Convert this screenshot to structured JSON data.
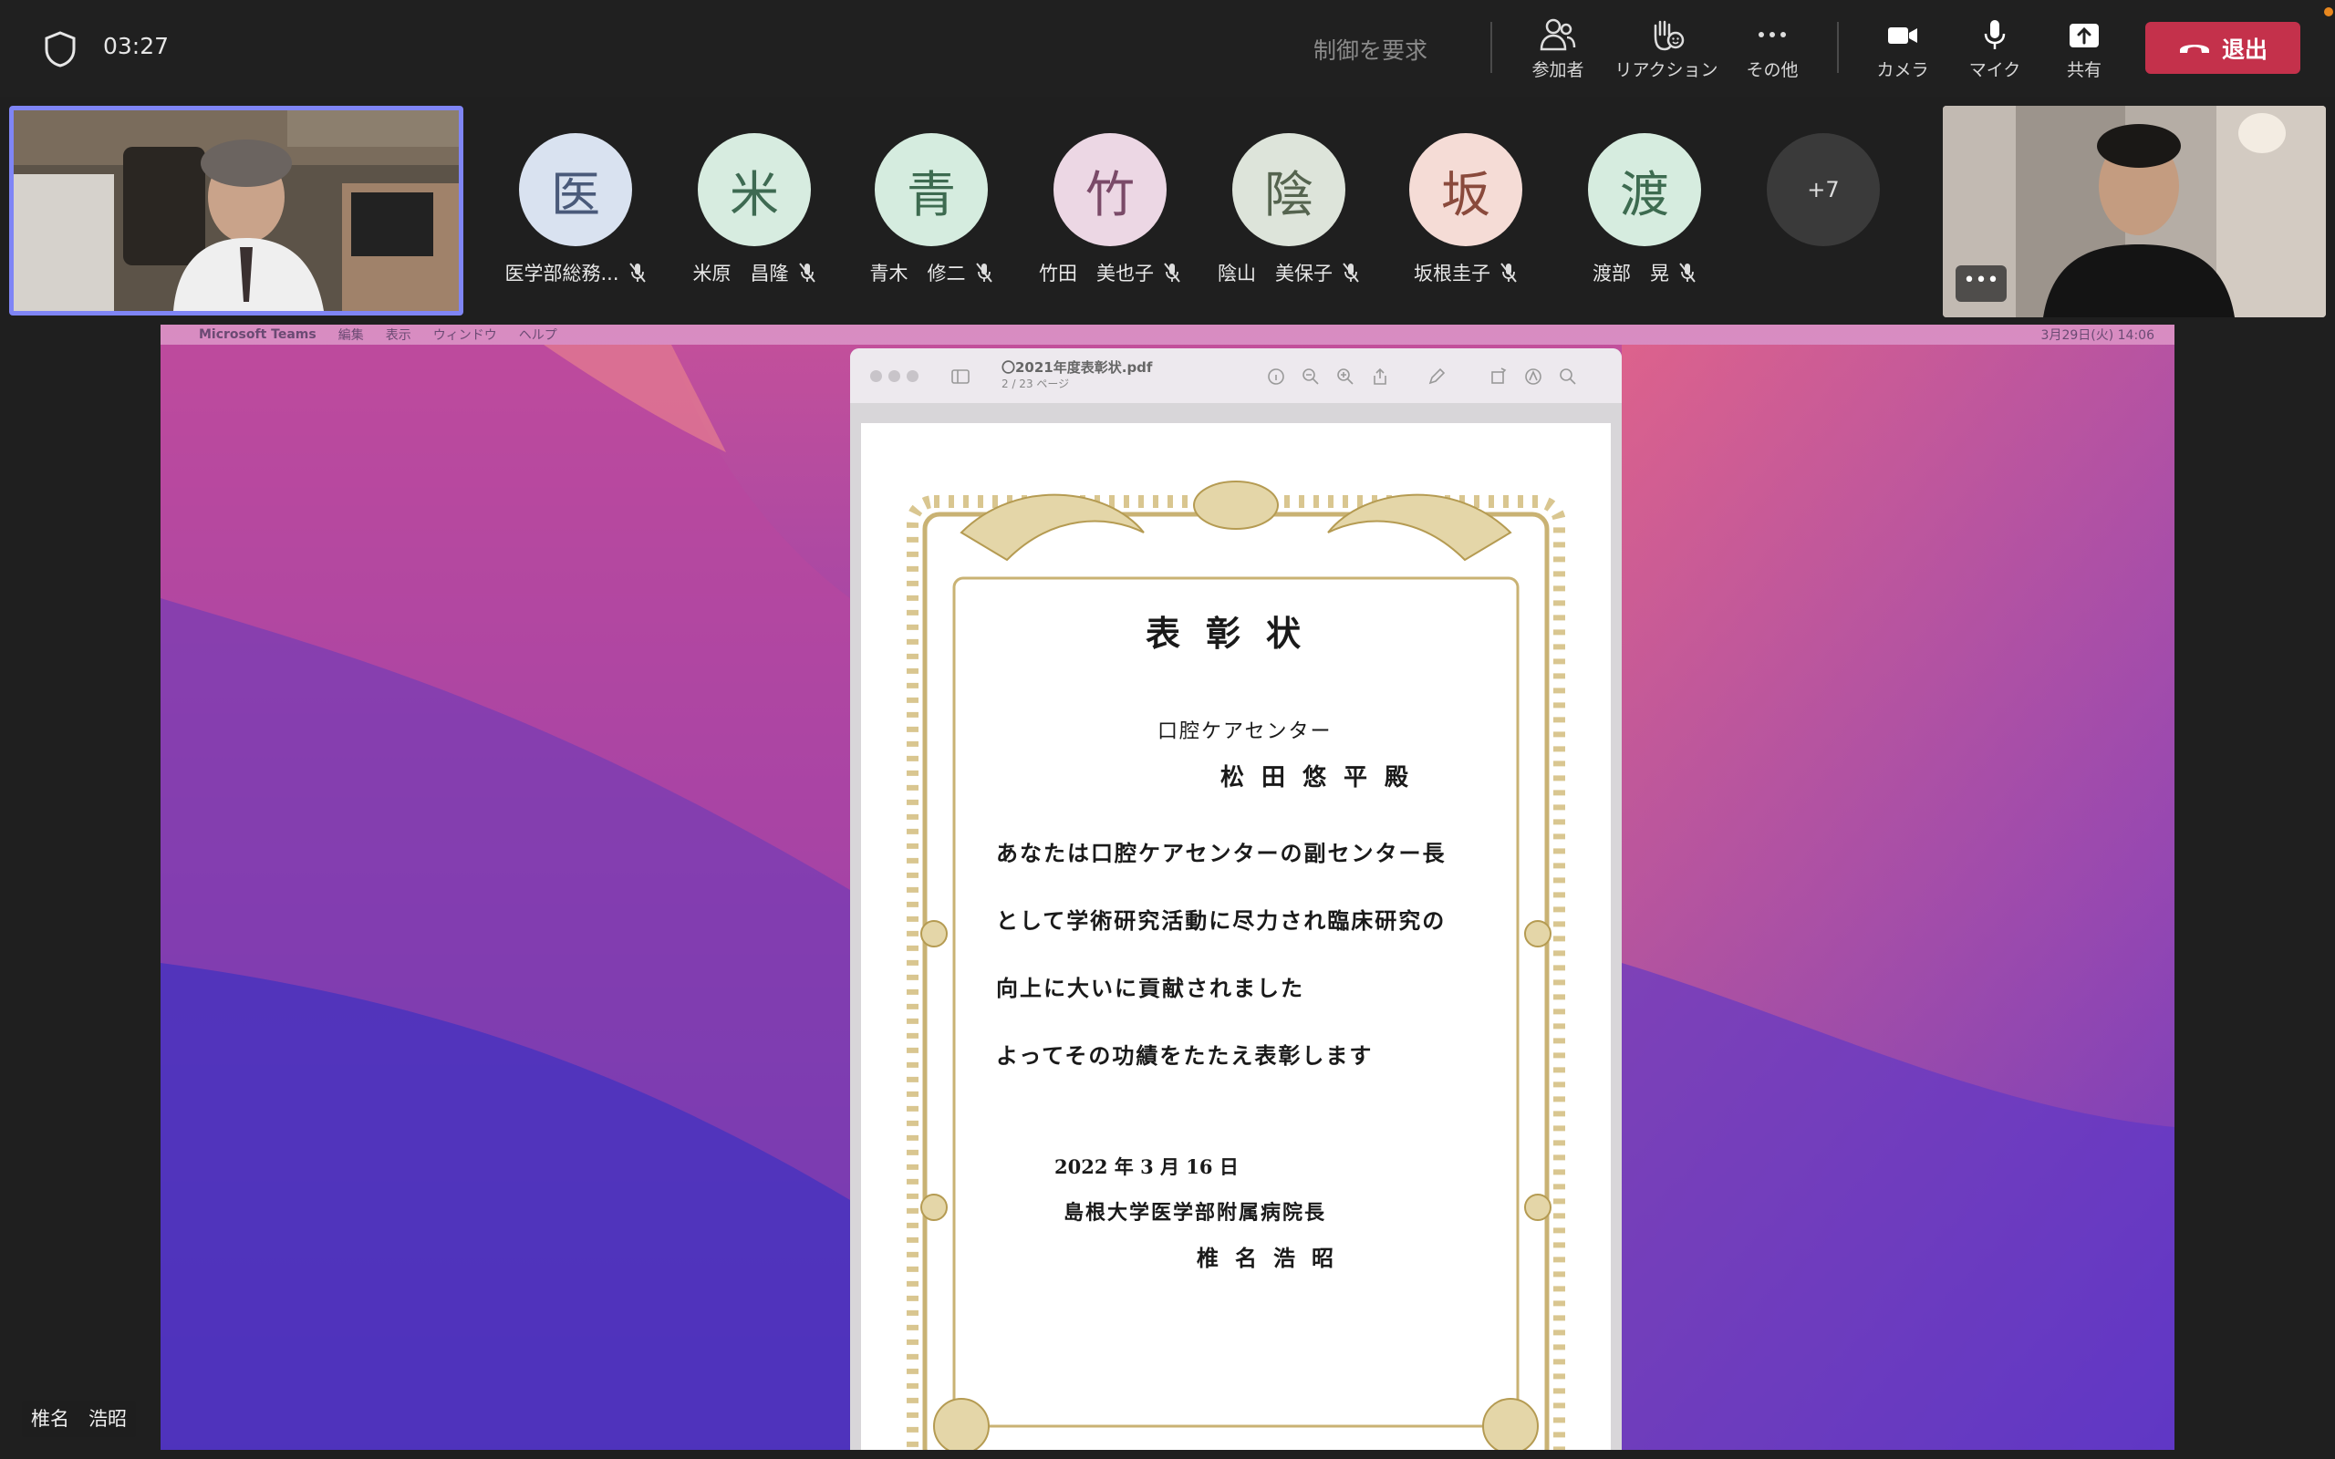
{
  "topbar": {
    "timer": "03:27",
    "request_control": "制御を要求",
    "buttons": {
      "participants": "参加者",
      "reactions": "リアクション",
      "more": "その他",
      "camera": "カメラ",
      "mic": "マイク",
      "share": "共有"
    },
    "leave": "退出"
  },
  "participants": [
    {
      "initial": "医",
      "name": "医学部総務...",
      "bg": "#d9e2f0",
      "fg": "#4a5a7a"
    },
    {
      "initial": "米",
      "name": "米原　昌隆",
      "bg": "#d7ece0",
      "fg": "#3e6a52"
    },
    {
      "initial": "青",
      "name": "青木　修二",
      "bg": "#d5ecdf",
      "fg": "#3d6b50"
    },
    {
      "initial": "竹",
      "name": "竹田　美也子",
      "bg": "#ecd7e4",
      "fg": "#7a4a68"
    },
    {
      "initial": "陰",
      "name": "陰山　美保子",
      "bg": "#dde4da",
      "fg": "#55644f"
    },
    {
      "initial": "坂",
      "name": "坂根圭子",
      "bg": "#f5dcd6",
      "fg": "#8a4a3c"
    },
    {
      "initial": "渡",
      "name": "渡部　晃",
      "bg": "#d6ecdf",
      "fg": "#3d6b50"
    }
  ],
  "overflow_count": "+7",
  "colors": {
    "accent": "#7f85f5",
    "leave": "#c4314b",
    "bar": "#202020"
  },
  "mac_menu": {
    "app": "Microsoft Teams",
    "items": [
      "編集",
      "表示",
      "ウィンドウ",
      "ヘルプ"
    ],
    "clock": "3月29日(火)  14:06"
  },
  "pdf": {
    "filename": "〇2021年度表彰状.pdf",
    "pages": "2 / 23 ページ"
  },
  "certificate": {
    "title": "表彰状",
    "department": "口腔ケアセンター",
    "recipient": "松田悠平殿",
    "body": [
      "あなたは口腔ケアセンターの副センター長",
      "として学術研究活動に尽力され臨床研究の",
      "向上に大いに貢献されました",
      "よってその功績をたたえ表彰します"
    ],
    "date": "2022 年 3 月 16 日",
    "org": "島根大学医学部附属病院長",
    "signer": "椎名浩昭"
  },
  "presenter_tag": "椎名　浩昭"
}
